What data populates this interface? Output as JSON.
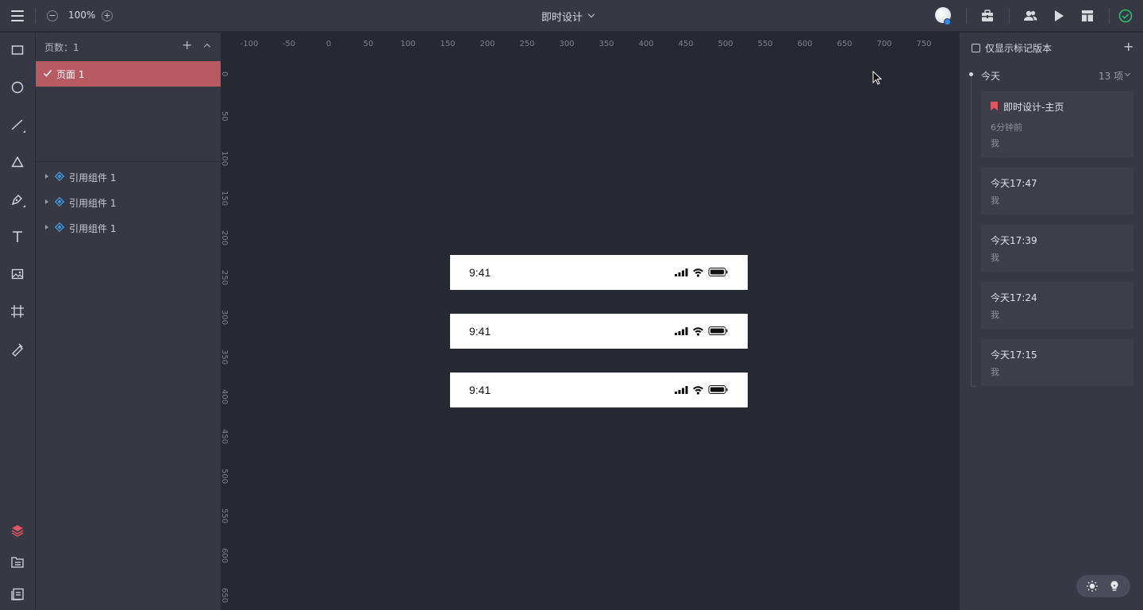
{
  "toolbar": {
    "zoom_level": "100%",
    "document_title": "即时设计"
  },
  "pages_panel": {
    "count_label": "页数：1",
    "pages": [
      {
        "label": "页面 1"
      }
    ],
    "layers": [
      {
        "label": "引用组件 1"
      },
      {
        "label": "引用组件 1"
      },
      {
        "label": "引用组件 1"
      }
    ]
  },
  "ruler": {
    "horizontal": [
      "-100",
      "-50",
      "0",
      "50",
      "100",
      "150",
      "200",
      "250",
      "300",
      "350",
      "400",
      "450",
      "500",
      "550",
      "600",
      "650",
      "700",
      "750"
    ],
    "vertical": [
      "0",
      "50",
      "100",
      "150",
      "200",
      "250",
      "300",
      "350",
      "400",
      "450",
      "500",
      "550",
      "600",
      "650"
    ]
  },
  "canvas": {
    "frames": [
      {
        "time": "9:41"
      },
      {
        "time": "9:41"
      },
      {
        "time": "9:41"
      }
    ]
  },
  "versions": {
    "filter_label": "仅显示标记版本",
    "group_label": "今天",
    "count_label": "13 项",
    "items": [
      {
        "title": "即时设计-主页",
        "time": "6分钟前",
        "author": "我",
        "marked": true
      },
      {
        "title": "今天17:47",
        "author": "我"
      },
      {
        "title": "今天17:39",
        "author": "我"
      },
      {
        "title": "今天17:24",
        "author": "我"
      },
      {
        "title": "今天17:15",
        "author": "我"
      }
    ]
  },
  "colors": {
    "accent": "#b85a62",
    "mark": "#e0555f",
    "saved": "#2fbf71"
  }
}
